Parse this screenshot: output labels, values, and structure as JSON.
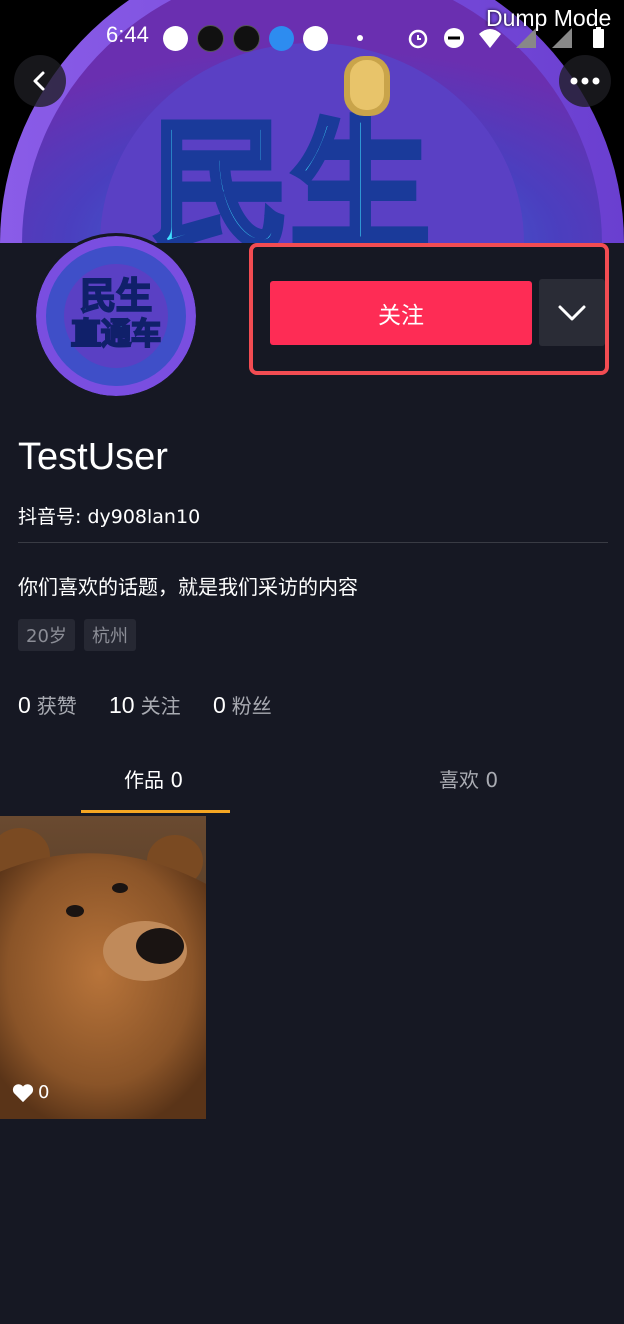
{
  "status_bar": {
    "time": "6:44",
    "debug_label": "Dump Mode"
  },
  "profile": {
    "username": "TestUser",
    "douyin_id": "抖音号: dy908lan10",
    "bio": "你们喜欢的话题，就是我们采访的内容",
    "tags": [
      "20岁",
      "杭州"
    ],
    "banner_text": "民生",
    "avatar_text_top": "民生",
    "avatar_text_bottom": "直通车"
  },
  "actions": {
    "follow_label": "关注"
  },
  "stats": [
    {
      "value": "0",
      "label": "获赞"
    },
    {
      "value": "10",
      "label": "关注"
    },
    {
      "value": "0",
      "label": "粉丝"
    }
  ],
  "tabs": [
    {
      "label": "作品 0",
      "active": true
    },
    {
      "label": "喜欢 0",
      "active": false
    }
  ],
  "videos": [
    {
      "likes": "0"
    }
  ],
  "colors": {
    "accent": "#fe2c55",
    "background": "#161823",
    "tab_underline": "#f5a623",
    "highlight_box": "#f24c52"
  }
}
